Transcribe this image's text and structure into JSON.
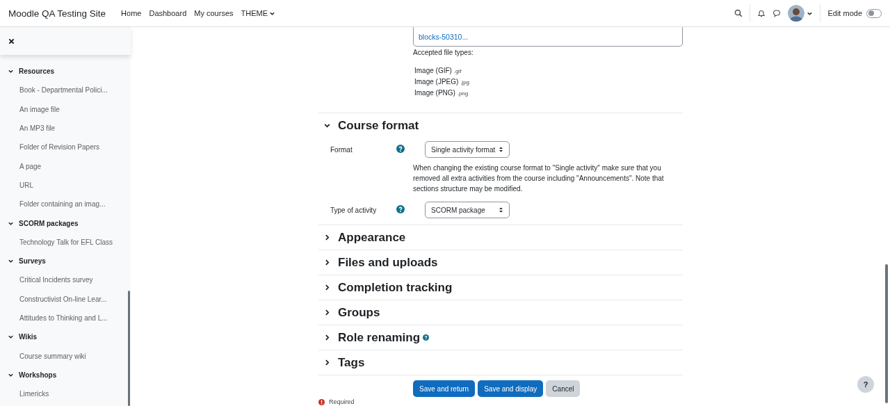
{
  "navbar": {
    "site_name": "Moodle QA Testing Site",
    "links": [
      {
        "label": "Home",
        "dropdown": false
      },
      {
        "label": "Dashboard",
        "dropdown": false
      },
      {
        "label": "My courses",
        "dropdown": false
      },
      {
        "label": "THEME",
        "dropdown": true
      }
    ],
    "edit_mode": {
      "label": "Edit mode",
      "on": false
    }
  },
  "sidebar": {
    "sections": [
      {
        "title": "Resources",
        "expanded": true,
        "children": [
          {
            "label": "Book - Departmental Polici..."
          },
          {
            "label": "An image file"
          },
          {
            "label": "An MP3 file"
          },
          {
            "label": "Folder of Revision Papers"
          },
          {
            "label": "A page"
          },
          {
            "label": "URL"
          },
          {
            "label": "Folder containing an imag..."
          }
        ]
      },
      {
        "title": "SCORM packages",
        "expanded": true,
        "children": [
          {
            "label": "Technology Talk for EFL Class"
          }
        ]
      },
      {
        "title": "Surveys",
        "expanded": true,
        "children": [
          {
            "label": "Critical Incidents survey"
          },
          {
            "label": "Constructivist On-line Lear..."
          },
          {
            "label": "Attitudes to Thinking and L..."
          }
        ]
      },
      {
        "title": "Wikis",
        "expanded": true,
        "children": [
          {
            "label": "Course summary wiki"
          }
        ]
      },
      {
        "title": "Workshops",
        "expanded": true,
        "children": [
          {
            "label": "Limericks"
          }
        ]
      }
    ]
  },
  "filepicker": {
    "file": "blocks-50310...",
    "accepted_label": "Accepted file types:",
    "types": [
      {
        "name": "Image (GIF)",
        "ext": ".gif"
      },
      {
        "name": "Image (JPEG)",
        "ext": ".jpg"
      },
      {
        "name": "Image (PNG)",
        "ext": ".png"
      }
    ]
  },
  "sections": [
    {
      "title": "Course format",
      "expanded": true,
      "help": false,
      "fields": [
        {
          "kind": "select",
          "label": "Format",
          "help": true,
          "value": "Single activity format"
        },
        {
          "kind": "note",
          "text": "When changing the existing course format to \"Single activity\" make sure that you removed all extra activities from the course including \"Announcements\". Note that sections structure may be modified."
        },
        {
          "kind": "select",
          "label": "Type of activity",
          "help": true,
          "value": "SCORM package"
        }
      ]
    },
    {
      "title": "Appearance",
      "expanded": false,
      "help": false
    },
    {
      "title": "Files and uploads",
      "expanded": false,
      "help": false
    },
    {
      "title": "Completion tracking",
      "expanded": false,
      "help": false
    },
    {
      "title": "Groups",
      "expanded": false,
      "help": false
    },
    {
      "title": "Role renaming",
      "expanded": false,
      "help": true
    },
    {
      "title": "Tags",
      "expanded": false,
      "help": false
    }
  ],
  "buttons": [
    {
      "label": "Save and return",
      "kind": "primary"
    },
    {
      "label": "Save and display",
      "kind": "primary"
    },
    {
      "label": "Cancel",
      "kind": "secondary"
    }
  ],
  "required_note": "Required",
  "help_button": "?"
}
